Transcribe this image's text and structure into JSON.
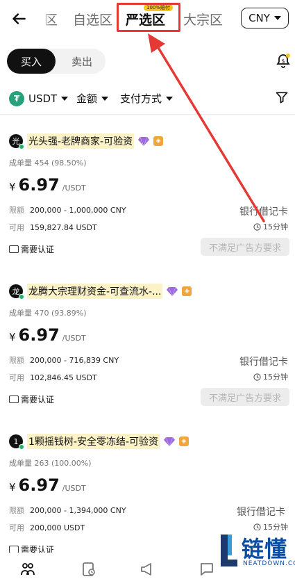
{
  "header": {
    "tabs": [
      {
        "label": "区"
      },
      {
        "label": "自选区"
      },
      {
        "label": "严选区",
        "badge": "100%赔付",
        "active": true
      },
      {
        "label": "大宗区"
      }
    ],
    "currency": "CNY"
  },
  "trade_toggle": {
    "buy": "买入",
    "sell": "卖出"
  },
  "filters": {
    "coin": "USDT",
    "amount": "金额",
    "payment": "支付方式"
  },
  "offers": [
    {
      "avatar": "光",
      "merchant": "光头强-老牌商家-可验资",
      "stats": "成单量 454 (98.50%)",
      "currency_symbol": "¥",
      "price": "6.97",
      "unit": "/USDT",
      "limit_label": "限额",
      "limit": "200,000 - 1,000,000 CNY",
      "available_label": "可用",
      "available": "159,827.84 USDT",
      "payment": "银行借记卡",
      "time": "15分钟",
      "verify": "需要认证",
      "action": "不满足广告方要求"
    },
    {
      "avatar": "龙",
      "merchant": "龙腾大宗理财资金-可查流水-...",
      "stats": "成单量 470 (93.89%)",
      "currency_symbol": "¥",
      "price": "6.97",
      "unit": "/USDT",
      "limit_label": "限额",
      "limit": "200,000 - 716,839 CNY",
      "available_label": "可用",
      "available": "102,846.45 USDT",
      "payment": "银行借记卡",
      "time": "15分钟",
      "verify": "需要认证",
      "action": "不满足广告方要求"
    },
    {
      "avatar": "1",
      "merchant": "1颗摇钱树-安全零冻结-可验资",
      "stats": "成单量 263 (100.00%)",
      "currency_symbol": "¥",
      "price": "6.97",
      "unit": "/USDT",
      "limit_label": "限额",
      "limit": "200,000 - 1,394,000 CNY",
      "available_label": "可用",
      "available": "200,000 USDT",
      "payment": "银行借记卡",
      "time": "15分钟",
      "verify": "需要认证",
      "action": ""
    }
  ],
  "watermark": {
    "title": "链懂",
    "subtitle": "NEATDOWN.COM"
  },
  "colors": {
    "highlight": "#e53935",
    "usdt": "#26a17b",
    "merchant_bg": "#fbf2c8",
    "watermark": "#0d4ea3"
  },
  "icons": [
    "back-arrow-icon",
    "bell-icon",
    "filter-icon",
    "diamond-icon",
    "shield-icon",
    "clock-icon",
    "id-card-icon",
    "p2p-icon",
    "orders-icon",
    "megaphone-icon",
    "message-icon"
  ]
}
